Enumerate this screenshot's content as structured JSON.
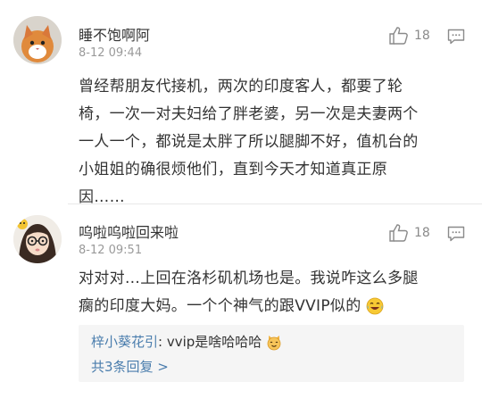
{
  "comments": [
    {
      "username": "睡不饱啊阿",
      "time": "8-12 09:44",
      "likes": "18",
      "avatar_icon": "cat-avatar-icon",
      "body_lines": [
        "曾经帮朋友代接机，两次的印度客人，都要了轮",
        "椅，一次一对夫妇给了胖老婆，另一次是夫妻两个",
        "一人一个，都说是太胖了所以腿脚不好，值机台的",
        "小姐姐的确很烦他们，直到今天才知道真正原",
        "因……"
      ]
    },
    {
      "username": "呜啦呜啦回来啦",
      "time": "8-12 09:51",
      "likes": "18",
      "avatar_icon": "girl-avatar-icon",
      "body_lines": [
        "对对对…上回在洛杉矶机场也是。我说咋这么多腿",
        "瘸的印度大妈。一个个神气的跟VVIP似的"
      ],
      "body_emoji": "laugh-cry-emoji-icon",
      "reply": {
        "author": "梓小葵花引",
        "separator": ":",
        "text": " vvip是啥哈哈哈",
        "emoji": "cat-emoji-icon",
        "more": "共3条回复 >"
      }
    }
  ],
  "colors": {
    "link": "#4a7dad",
    "meta": "#9a9a9a",
    "reply_bg": "#f5f5f5"
  }
}
